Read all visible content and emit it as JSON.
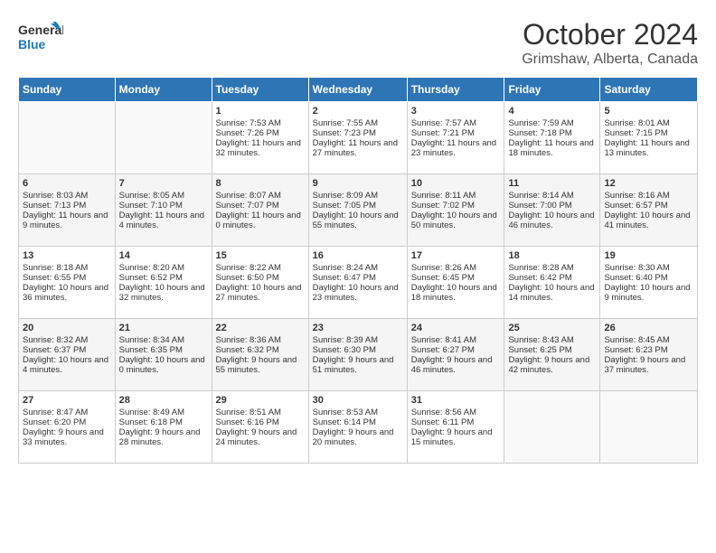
{
  "header": {
    "logo_line1": "General",
    "logo_line2": "Blue",
    "month": "October 2024",
    "location": "Grimshaw, Alberta, Canada"
  },
  "days_of_week": [
    "Sunday",
    "Monday",
    "Tuesday",
    "Wednesday",
    "Thursday",
    "Friday",
    "Saturday"
  ],
  "weeks": [
    [
      {
        "day": "",
        "sunrise": "",
        "sunset": "",
        "daylight": ""
      },
      {
        "day": "",
        "sunrise": "",
        "sunset": "",
        "daylight": ""
      },
      {
        "day": "1",
        "sunrise": "Sunrise: 7:53 AM",
        "sunset": "Sunset: 7:26 PM",
        "daylight": "Daylight: 11 hours and 32 minutes."
      },
      {
        "day": "2",
        "sunrise": "Sunrise: 7:55 AM",
        "sunset": "Sunset: 7:23 PM",
        "daylight": "Daylight: 11 hours and 27 minutes."
      },
      {
        "day": "3",
        "sunrise": "Sunrise: 7:57 AM",
        "sunset": "Sunset: 7:21 PM",
        "daylight": "Daylight: 11 hours and 23 minutes."
      },
      {
        "day": "4",
        "sunrise": "Sunrise: 7:59 AM",
        "sunset": "Sunset: 7:18 PM",
        "daylight": "Daylight: 11 hours and 18 minutes."
      },
      {
        "day": "5",
        "sunrise": "Sunrise: 8:01 AM",
        "sunset": "Sunset: 7:15 PM",
        "daylight": "Daylight: 11 hours and 13 minutes."
      }
    ],
    [
      {
        "day": "6",
        "sunrise": "Sunrise: 8:03 AM",
        "sunset": "Sunset: 7:13 PM",
        "daylight": "Daylight: 11 hours and 9 minutes."
      },
      {
        "day": "7",
        "sunrise": "Sunrise: 8:05 AM",
        "sunset": "Sunset: 7:10 PM",
        "daylight": "Daylight: 11 hours and 4 minutes."
      },
      {
        "day": "8",
        "sunrise": "Sunrise: 8:07 AM",
        "sunset": "Sunset: 7:07 PM",
        "daylight": "Daylight: 11 hours and 0 minutes."
      },
      {
        "day": "9",
        "sunrise": "Sunrise: 8:09 AM",
        "sunset": "Sunset: 7:05 PM",
        "daylight": "Daylight: 10 hours and 55 minutes."
      },
      {
        "day": "10",
        "sunrise": "Sunrise: 8:11 AM",
        "sunset": "Sunset: 7:02 PM",
        "daylight": "Daylight: 10 hours and 50 minutes."
      },
      {
        "day": "11",
        "sunrise": "Sunrise: 8:14 AM",
        "sunset": "Sunset: 7:00 PM",
        "daylight": "Daylight: 10 hours and 46 minutes."
      },
      {
        "day": "12",
        "sunrise": "Sunrise: 8:16 AM",
        "sunset": "Sunset: 6:57 PM",
        "daylight": "Daylight: 10 hours and 41 minutes."
      }
    ],
    [
      {
        "day": "13",
        "sunrise": "Sunrise: 8:18 AM",
        "sunset": "Sunset: 6:55 PM",
        "daylight": "Daylight: 10 hours and 36 minutes."
      },
      {
        "day": "14",
        "sunrise": "Sunrise: 8:20 AM",
        "sunset": "Sunset: 6:52 PM",
        "daylight": "Daylight: 10 hours and 32 minutes."
      },
      {
        "day": "15",
        "sunrise": "Sunrise: 8:22 AM",
        "sunset": "Sunset: 6:50 PM",
        "daylight": "Daylight: 10 hours and 27 minutes."
      },
      {
        "day": "16",
        "sunrise": "Sunrise: 8:24 AM",
        "sunset": "Sunset: 6:47 PM",
        "daylight": "Daylight: 10 hours and 23 minutes."
      },
      {
        "day": "17",
        "sunrise": "Sunrise: 8:26 AM",
        "sunset": "Sunset: 6:45 PM",
        "daylight": "Daylight: 10 hours and 18 minutes."
      },
      {
        "day": "18",
        "sunrise": "Sunrise: 8:28 AM",
        "sunset": "Sunset: 6:42 PM",
        "daylight": "Daylight: 10 hours and 14 minutes."
      },
      {
        "day": "19",
        "sunrise": "Sunrise: 8:30 AM",
        "sunset": "Sunset: 6:40 PM",
        "daylight": "Daylight: 10 hours and 9 minutes."
      }
    ],
    [
      {
        "day": "20",
        "sunrise": "Sunrise: 8:32 AM",
        "sunset": "Sunset: 6:37 PM",
        "daylight": "Daylight: 10 hours and 4 minutes."
      },
      {
        "day": "21",
        "sunrise": "Sunrise: 8:34 AM",
        "sunset": "Sunset: 6:35 PM",
        "daylight": "Daylight: 10 hours and 0 minutes."
      },
      {
        "day": "22",
        "sunrise": "Sunrise: 8:36 AM",
        "sunset": "Sunset: 6:32 PM",
        "daylight": "Daylight: 9 hours and 55 minutes."
      },
      {
        "day": "23",
        "sunrise": "Sunrise: 8:39 AM",
        "sunset": "Sunset: 6:30 PM",
        "daylight": "Daylight: 9 hours and 51 minutes."
      },
      {
        "day": "24",
        "sunrise": "Sunrise: 8:41 AM",
        "sunset": "Sunset: 6:27 PM",
        "daylight": "Daylight: 9 hours and 46 minutes."
      },
      {
        "day": "25",
        "sunrise": "Sunrise: 8:43 AM",
        "sunset": "Sunset: 6:25 PM",
        "daylight": "Daylight: 9 hours and 42 minutes."
      },
      {
        "day": "26",
        "sunrise": "Sunrise: 8:45 AM",
        "sunset": "Sunset: 6:23 PM",
        "daylight": "Daylight: 9 hours and 37 minutes."
      }
    ],
    [
      {
        "day": "27",
        "sunrise": "Sunrise: 8:47 AM",
        "sunset": "Sunset: 6:20 PM",
        "daylight": "Daylight: 9 hours and 33 minutes."
      },
      {
        "day": "28",
        "sunrise": "Sunrise: 8:49 AM",
        "sunset": "Sunset: 6:18 PM",
        "daylight": "Daylight: 9 hours and 28 minutes."
      },
      {
        "day": "29",
        "sunrise": "Sunrise: 8:51 AM",
        "sunset": "Sunset: 6:16 PM",
        "daylight": "Daylight: 9 hours and 24 minutes."
      },
      {
        "day": "30",
        "sunrise": "Sunrise: 8:53 AM",
        "sunset": "Sunset: 6:14 PM",
        "daylight": "Daylight: 9 hours and 20 minutes."
      },
      {
        "day": "31",
        "sunrise": "Sunrise: 8:56 AM",
        "sunset": "Sunset: 6:11 PM",
        "daylight": "Daylight: 9 hours and 15 minutes."
      },
      {
        "day": "",
        "sunrise": "",
        "sunset": "",
        "daylight": ""
      },
      {
        "day": "",
        "sunrise": "",
        "sunset": "",
        "daylight": ""
      }
    ]
  ]
}
